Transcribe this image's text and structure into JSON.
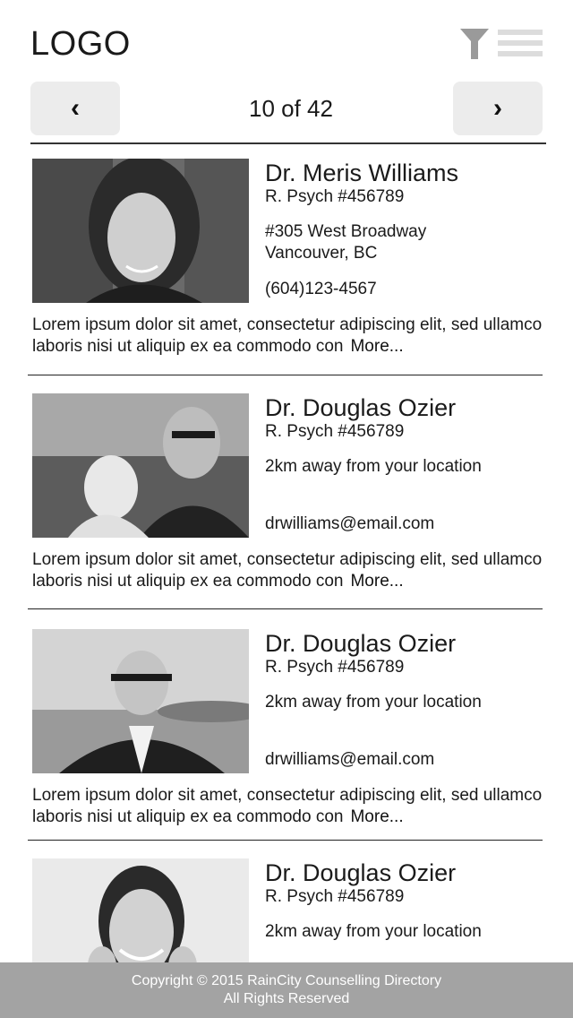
{
  "header": {
    "logo": "LOGO",
    "filter_icon": "filter-icon",
    "menu_icon": "hamburger-menu-icon"
  },
  "pager": {
    "prev_label": "‹",
    "next_label": "›",
    "count": "10 of 42"
  },
  "cards": [
    {
      "name": "Dr. Meris Williams",
      "registration": "R. Psych #456789",
      "address_line1": "#305 West Broadway",
      "address_line2": "Vancouver, BC",
      "phone": "(604)123-4567",
      "description": "Lorem ipsum dolor sit amet, consectetur adipiscing elit, sed ullamco laboris nisi ut aliquip ex ea commodo con",
      "more": "More..."
    },
    {
      "name": "Dr. Douglas Ozier",
      "registration": "R. Psych #456789",
      "distance": "2km away from your location",
      "email": "drwilliams@email.com",
      "description": "Lorem ipsum dolor sit amet, consectetur adipiscing elit, sed ullamco laboris nisi ut aliquip ex ea commodo con",
      "more": "More..."
    },
    {
      "name": "Dr. Douglas Ozier",
      "registration": "R. Psych #456789",
      "distance": "2km away from your location",
      "email": "drwilliams@email.com",
      "description": "Lorem ipsum dolor sit amet, consectetur adipiscing elit, sed ullamco laboris nisi ut aliquip ex ea commodo con",
      "more": "More..."
    },
    {
      "name": "Dr. Douglas Ozier",
      "registration": "R. Psych #456789",
      "distance": "2km away from your location"
    }
  ],
  "footer": {
    "line1": "Copyright © 2015 RainCity Counselling Directory",
    "line2": "All Rights Reserved"
  }
}
